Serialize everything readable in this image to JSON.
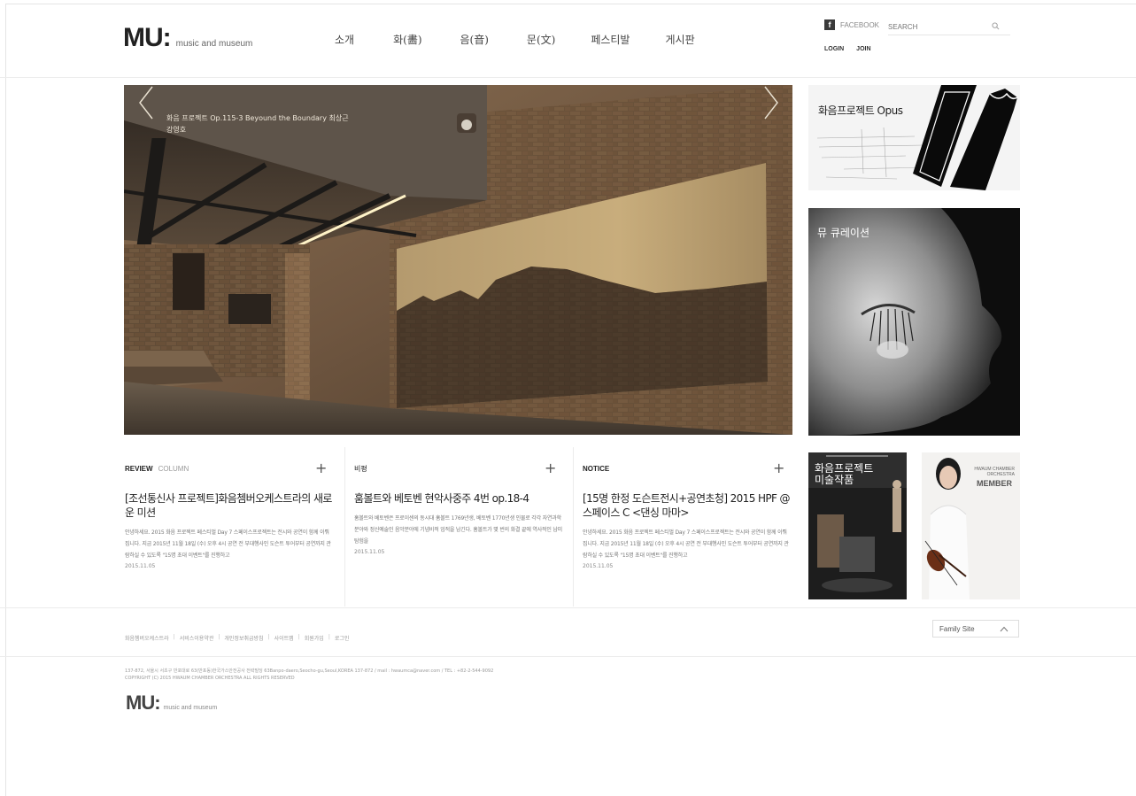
{
  "header": {
    "logo": "MU:",
    "logo_sub": "music and museum",
    "nav": [
      "소개",
      "화(畵)",
      "음(音)",
      "문(文)",
      "페스티발",
      "게시판"
    ],
    "facebook_label": "FACEBOOK",
    "search_label": "SEARCH",
    "login": "LOGIN",
    "join": "JOIN"
  },
  "hero": {
    "caption_line1": "화음 프로젝트 Op.115-3 Beyound the Boundary  최상근",
    "caption_line2": "강영호"
  },
  "banners": {
    "opus": "화음프로젝트 Opus",
    "curation": "뮤 큐레이션",
    "artwork_line1": "화음프로젝트",
    "artwork_line2": "미술작품",
    "member_small_1": "HWAUM CHAMBER",
    "member_small_2": "ORCHESTRA",
    "member": "MEMBER"
  },
  "columns": [
    {
      "tab_active": "REVIEW",
      "tab_inactive": "COLUMN",
      "title": "[조선통신사 프로젝트]화음쳄버오케스트라의 새로운 미션",
      "body": "안녕하세요. 2015 화음 프로젝트 페스티벌 Day 7 스페이스프로젝트는 전시와 공연이 함께 이뤄집니다. 지금 2015년 11월 18일 (수) 오후 4시 공연 전 부대행사인 도슨트 투어부터 공연까지 관람하실 수 있도록 \"15명 초대 이벤트\"를 진행하고",
      "date": "2015.11.05"
    },
    {
      "tab_active": "비평",
      "tab_inactive": "",
      "title": "훔볼트와 베토벤 현악사중주 4번 op.18-4",
      "body": "훔볼트와 베토벤은 프로이센의 동시대 훔볼트 1769년생, 베토벤 1770년생 인물로 각각 자연과학 분야와 정신예술인 음악분야에 기념비적 업적을 남긴다. 훔볼트가 몇 번의 화결 끝에 역사적인 남미 탐험을",
      "date": "2015.11.05"
    },
    {
      "tab_active": "NOTICE",
      "tab_inactive": "",
      "title": "[15명 한정 도슨트전시+공연초청] 2015 HPF @스페이스 C <댄싱 마마>",
      "body": "안녕하세요. 2015 화음 프로젝트 페스티벌 Day 7 스페이스프로젝트는 전시와 공연이 함께 이뤄집니다. 지금 2015년 11월 18일 (수) 오후 4시 공연 전 부대행사인 도슨트 투어부터 공연까지 관람하실 수 있도록 \"15명 초대 이벤트\"를 진행하고",
      "date": "2015.11.05"
    }
  ],
  "footer": {
    "links": [
      "화음쳄버오케스트라",
      "서비스이용약관",
      "개인정보취급방침",
      "사이트맵",
      "회원가입",
      "로그인"
    ],
    "family_site": "Family Site",
    "address": "137-872, 서울시 서초구 반포대로 63(반포동)한국가스안전공사 전략빌딩 63Banpo-daero,Seocho-gu,Seoul,KOREA 137-872 / mail : hwaumca@naver.com  /  TEL : +82-2-544-9092",
    "copyright": "COPYRIGHT (C) 2015 HWAUM CHAMBER ORCHESTRA ALL RIGHTS RESERVED",
    "logo": "MU:",
    "logo_sub": "music and museum"
  }
}
